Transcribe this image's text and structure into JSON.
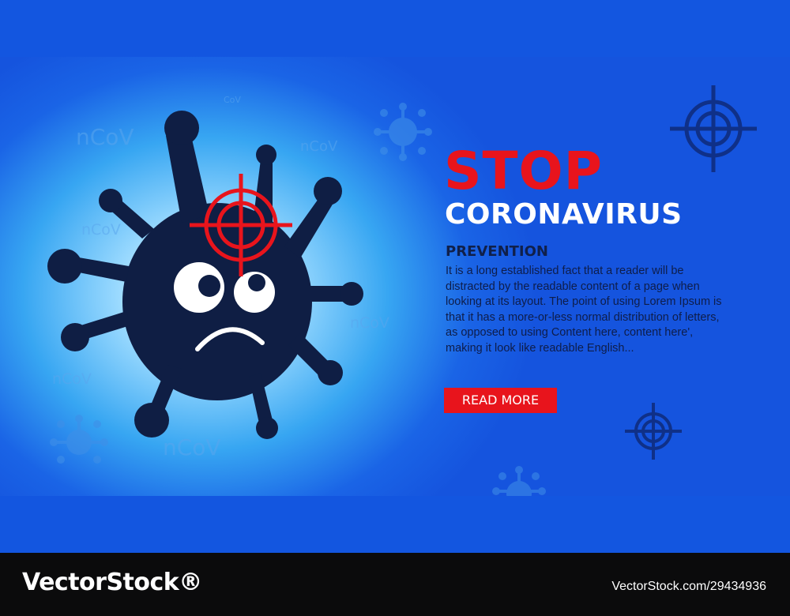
{
  "background_labels": [
    "nCoV",
    "nCoV",
    "nCoV",
    "nCoV",
    "nCoV",
    "nCoV",
    "CoV"
  ],
  "hero": {
    "title_stop": "STOP",
    "title_main": "CORONAVIRUS"
  },
  "article": {
    "heading": "PREVENTION",
    "body": "It is a long established fact that a reader will be distracted by the readable content of a page when looking at its layout. The point of using Lorem Ipsum is that it has a more-or-less normal distribution of letters, as opposed to using Content here, content here', making it look like readable English...",
    "button_label": "READ MORE"
  },
  "footer": {
    "logo": "VectorStock®",
    "image_id": "VectorStock.com/29434936"
  },
  "colors": {
    "accent_red": "#e8141c",
    "virus_body": "#0f1e44",
    "page_blue": "#1356e0",
    "footer_black": "#0b0b0c"
  },
  "icons": [
    "virus-icon",
    "crosshair-icon"
  ]
}
